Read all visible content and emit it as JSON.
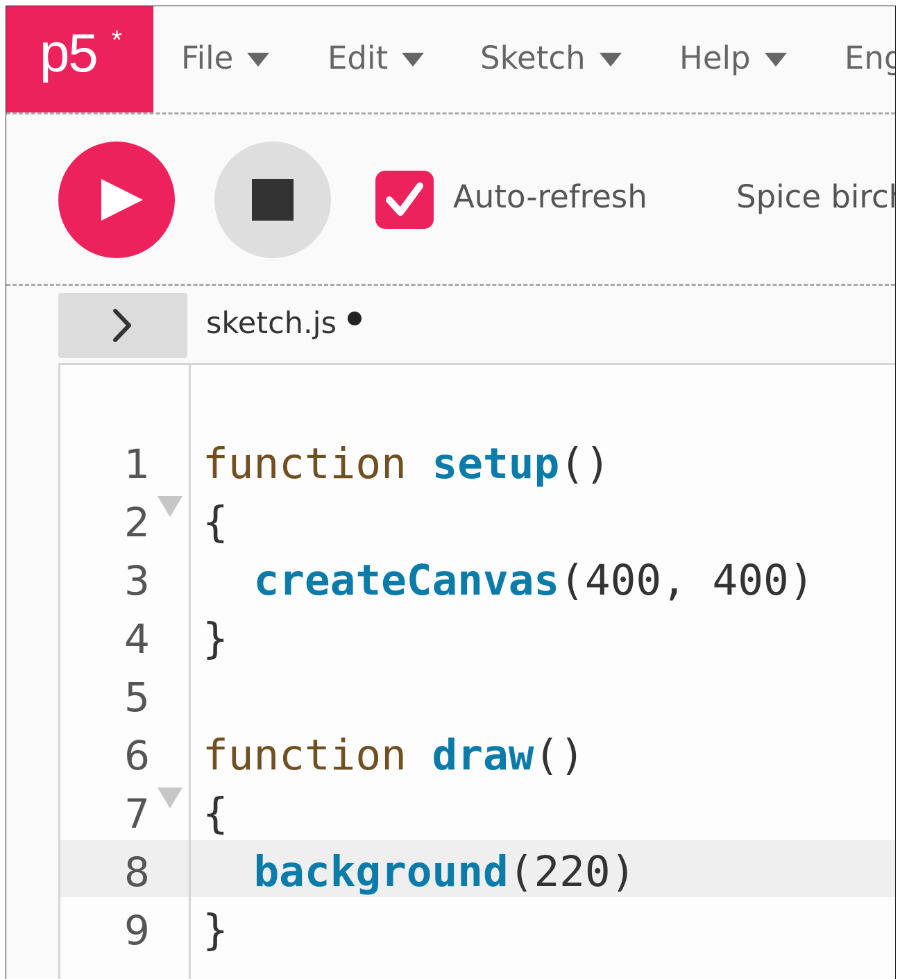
{
  "app": {
    "logo_text": "p5",
    "logo_star": "*",
    "brand_color": "#ed225d"
  },
  "menu": [
    {
      "label": "File"
    },
    {
      "label": "Edit"
    },
    {
      "label": "Sketch"
    },
    {
      "label": "Help"
    },
    {
      "label": "Eng"
    }
  ],
  "toolbar": {
    "play_icon": "play-icon",
    "stop_icon": "stop-icon",
    "auto_refresh_label": "Auto-refresh",
    "auto_refresh_checked": true,
    "sketch_name": "Spice birch"
  },
  "editor": {
    "file_tab": "sketch.js",
    "unsaved": true,
    "active_line": 8,
    "lines": [
      {
        "num": "1",
        "tokens": [
          [
            "function",
            "kw"
          ],
          [
            " ",
            "pl"
          ],
          [
            "setup",
            "fn"
          ],
          [
            "()",
            "pl"
          ]
        ]
      },
      {
        "num": "2",
        "fold": true,
        "tokens": [
          [
            "{",
            "pl"
          ]
        ]
      },
      {
        "num": "3",
        "tokens": [
          [
            "  ",
            "pl"
          ],
          [
            "createCanvas",
            "fn"
          ],
          [
            "(400, 400)",
            "pl"
          ]
        ]
      },
      {
        "num": "4",
        "tokens": [
          [
            "}",
            "pl"
          ]
        ]
      },
      {
        "num": "5",
        "tokens": []
      },
      {
        "num": "6",
        "tokens": [
          [
            "function",
            "kw"
          ],
          [
            " ",
            "pl"
          ],
          [
            "draw",
            "fn"
          ],
          [
            "()",
            "pl"
          ]
        ]
      },
      {
        "num": "7",
        "fold": true,
        "tokens": [
          [
            "{",
            "pl"
          ]
        ]
      },
      {
        "num": "8",
        "tokens": [
          [
            "  ",
            "pl"
          ],
          [
            "background",
            "fn"
          ],
          [
            "(220)",
            "pl"
          ]
        ]
      },
      {
        "num": "9",
        "tokens": [
          [
            "}",
            "pl"
          ]
        ]
      }
    ]
  }
}
